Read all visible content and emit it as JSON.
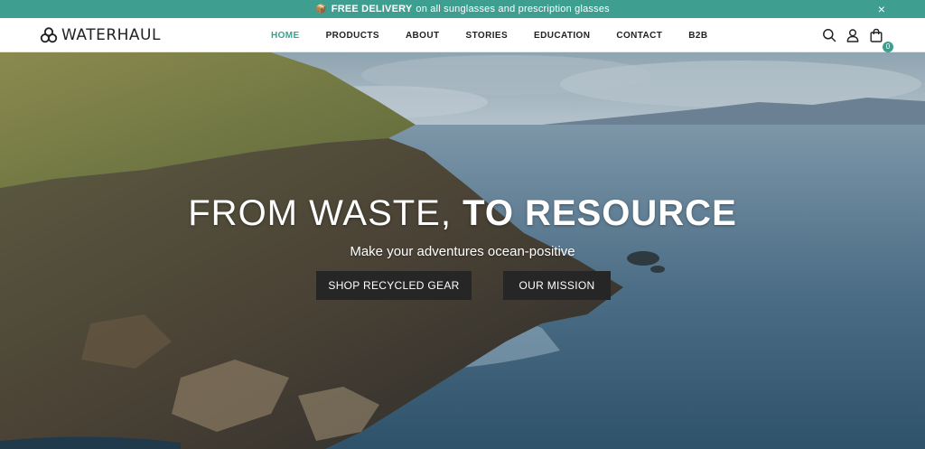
{
  "announcement": {
    "emoji": "📦",
    "bold_text": "FREE DELIVERY",
    "text": "on all sunglasses and prescription glasses",
    "close_icon": "×"
  },
  "header": {
    "logo_text": "WATERHAUL",
    "nav": [
      {
        "label": "HOME",
        "active": true
      },
      {
        "label": "PRODUCTS",
        "active": false
      },
      {
        "label": "ABOUT",
        "active": false
      },
      {
        "label": "STORIES",
        "active": false
      },
      {
        "label": "EDUCATION",
        "active": false
      },
      {
        "label": "CONTACT",
        "active": false
      },
      {
        "label": "B2B",
        "active": false
      }
    ],
    "icons": [
      "search-icon",
      "user-icon",
      "shopping-bag-icon"
    ],
    "cart_count": "0"
  },
  "hero": {
    "title_light": "FROM WASTE,",
    "title_bold": "TO RESOURCE",
    "subtitle": "Make your adventures ocean-positive",
    "primary_button": "SHOP RECYCLED GEAR",
    "secondary_button": "OUR MISSION"
  },
  "colors": {
    "accent": "#3e9e8f",
    "button_bg": "#262626"
  }
}
